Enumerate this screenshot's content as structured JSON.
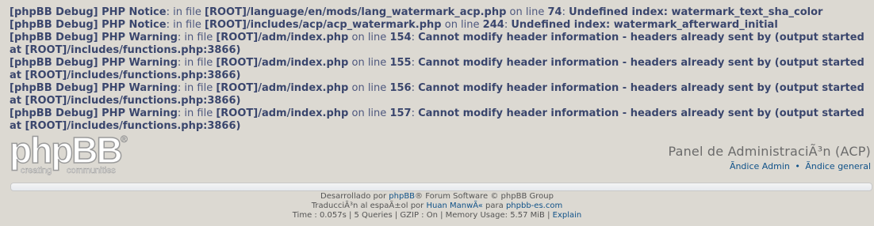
{
  "debug_lines": [
    {
      "tag": "[phpBB Debug] PHP Notice",
      "in_file": "in file",
      "path": "[ROOT]/language/en/mods/lang_watermark_acp.php",
      "on_line": "on line",
      "line": "74",
      "message": "Undefined index: watermark_text_sha_color"
    },
    {
      "tag": "[phpBB Debug] PHP Notice",
      "in_file": "in file",
      "path": "[ROOT]/includes/acp/acp_watermark.php",
      "on_line": "on line",
      "line": "244",
      "message": "Undefined index: watermark_afterward_initial"
    },
    {
      "tag": "[phpBB Debug] PHP Warning",
      "in_file": "in file",
      "path": "[ROOT]/adm/index.php",
      "on_line": "on line",
      "line": "154",
      "message": "Cannot modify header information - headers already sent by (output started at [ROOT]/includes/functions.php:3866)"
    },
    {
      "tag": "[phpBB Debug] PHP Warning",
      "in_file": "in file",
      "path": "[ROOT]/adm/index.php",
      "on_line": "on line",
      "line": "155",
      "message": "Cannot modify header information - headers already sent by (output started at [ROOT]/includes/functions.php:3866)"
    },
    {
      "tag": "[phpBB Debug] PHP Warning",
      "in_file": "in file",
      "path": "[ROOT]/adm/index.php",
      "on_line": "on line",
      "line": "156",
      "message": "Cannot modify header information - headers already sent by (output started at [ROOT]/includes/functions.php:3866)"
    },
    {
      "tag": "[phpBB Debug] PHP Warning",
      "in_file": "in file",
      "path": "[ROOT]/adm/index.php",
      "on_line": "on line",
      "line": "157",
      "message": "Cannot modify header information - headers already sent by (output started at [ROOT]/includes/functions.php:3866)"
    }
  ],
  "logo": {
    "name": "phpBB",
    "tagline_left": "creating",
    "tagline_right": "communities"
  },
  "header": {
    "title": "Panel de AdministraciÃ³n (ACP)",
    "link_admin": "Ãndice Admin",
    "separator": "•",
    "link_general": "Ãndice general"
  },
  "footer": {
    "line1_prefix": "Desarrollado por",
    "line1_link": "phpBB",
    "line1_suffix": "® Forum Software © phpBB Group",
    "line2_prefix": "TraducciÃ³n al espaÃ±ol por",
    "line2_author": "Huan ManwÃ«",
    "line2_mid": "para",
    "line2_link": "phpbb-es.com",
    "line3_stats": "Time : 0.057s | 5 Queries | GZIP : On | Memory Usage: 5.57 MiB |",
    "line3_link": "Explain"
  },
  "colors": {
    "background": "#dcd9d2",
    "text": "#3e4a73",
    "link": "#105289"
  }
}
